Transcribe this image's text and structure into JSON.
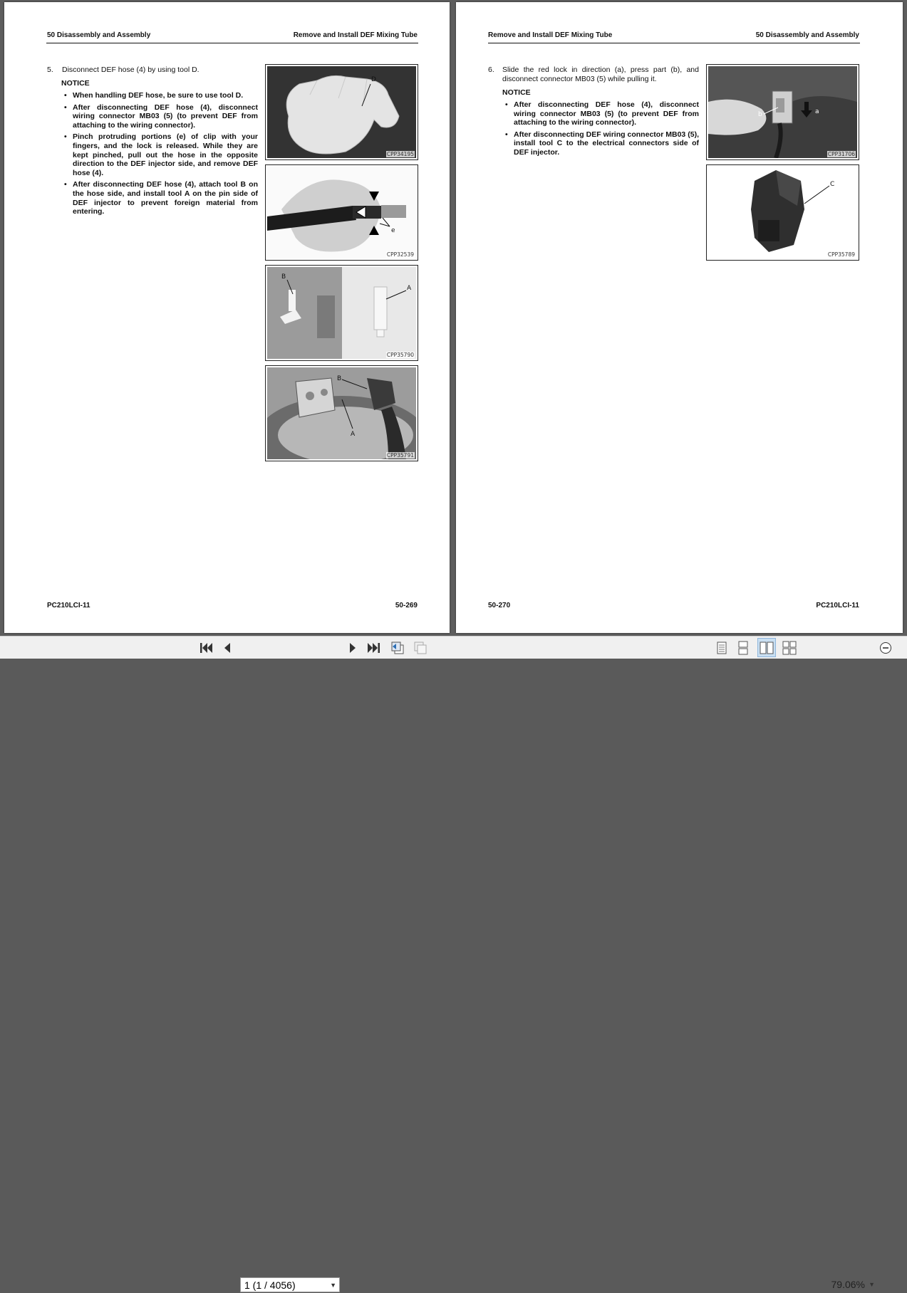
{
  "left_page": {
    "header_left": "50 Disassembly and Assembly",
    "header_right": "Remove and Install DEF Mixing Tube",
    "step_number": "5.",
    "step_text": "Disconnect DEF hose (4) by using tool D.",
    "notice": "NOTICE",
    "bullets": [
      "When handling DEF hose, be sure to use tool D.",
      "After disconnecting DEF hose (4), disconnect wiring connector MB03 (5) (to prevent DEF from attaching to the wiring connector).",
      "Pinch protruding portions (e) of clip with your fingers, and the lock is released. While they are kept pinched, pull out the hose in the opposite direction to the DEF injector side, and remove DEF hose (4).",
      "After disconnecting DEF hose (4), attach tool B on the hose side, and install tool A on the pin side of DEF injector to prevent foreign material from entering."
    ],
    "figures": [
      {
        "code": "CPP34195",
        "labels": [
          "D"
        ]
      },
      {
        "code": "CPP32539",
        "labels": [
          "e"
        ]
      },
      {
        "code": "CPP35790",
        "labels": [
          "B",
          "A"
        ]
      },
      {
        "code": "CPP35791",
        "labels": [
          "B",
          "A"
        ]
      }
    ],
    "footer_left": "PC210LCI-11",
    "footer_right": "50-269"
  },
  "right_page": {
    "header_left": "Remove and Install DEF Mixing Tube",
    "header_right": "50 Disassembly and Assembly",
    "step_number": "6.",
    "step_text": "Slide the red lock in direction (a), press part (b), and disconnect connector MB03 (5) while pulling it.",
    "notice": "NOTICE",
    "bullets": [
      "After disconnecting DEF hose (4), disconnect wiring connector MB03 (5) (to prevent DEF from attaching to the wiring connector).",
      "After disconnecting DEF wiring connector MB03 (5), install tool C to the electrical connectors side of DEF injector."
    ],
    "figures": [
      {
        "code": "CPP31706",
        "labels": [
          "b",
          "a"
        ]
      },
      {
        "code": "CPP35789",
        "labels": [
          "C"
        ]
      }
    ],
    "footer_left": "50-270",
    "footer_right": "PC210LCI-11"
  },
  "toolbar": {
    "page_indicator": "1 (1 / 4056)",
    "zoom": "79.06%",
    "icons": [
      "first-page-icon",
      "previous-page-icon",
      "next-page-icon",
      "last-page-icon",
      "previous-view-icon",
      "next-view-icon",
      "single-page-view-icon",
      "continuous-view-icon",
      "facing-view-icon",
      "continuous-facing-view-icon",
      "zoom-out-icon"
    ]
  }
}
